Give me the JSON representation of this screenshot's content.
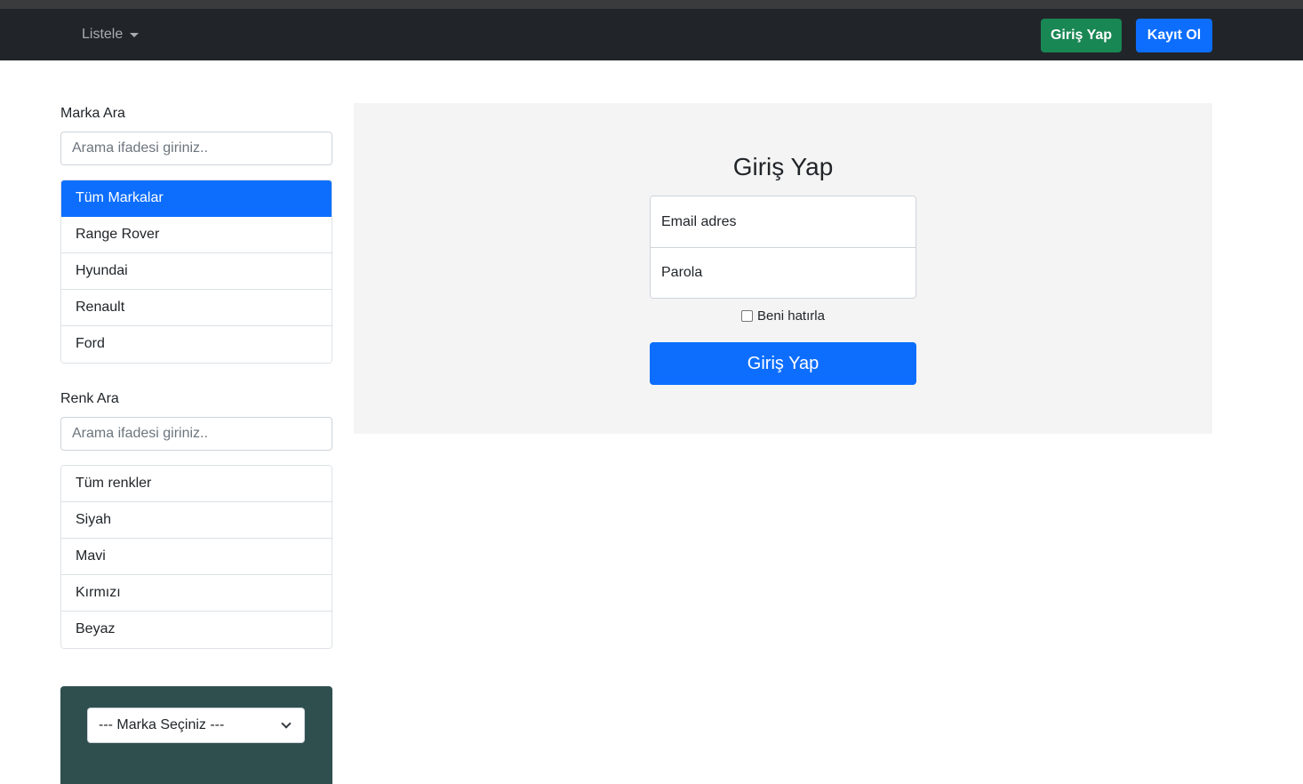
{
  "navbar": {
    "dropdown_label": "Listele",
    "login_label": "Giriş Yap",
    "register_label": "Kayıt Ol"
  },
  "brand_search": {
    "label": "Marka Ara",
    "placeholder": "Arama ifadesi giriniz..",
    "items": [
      {
        "label": "Tüm Markalar",
        "active": true
      },
      {
        "label": "Range Rover",
        "active": false
      },
      {
        "label": "Hyundai",
        "active": false
      },
      {
        "label": "Renault",
        "active": false
      },
      {
        "label": "Ford",
        "active": false
      }
    ]
  },
  "color_search": {
    "label": "Renk Ara",
    "placeholder": "Arama ifadesi giriniz..",
    "items": [
      {
        "label": "Tüm renkler",
        "active": false
      },
      {
        "label": "Siyah",
        "active": false
      },
      {
        "label": "Mavi",
        "active": false
      },
      {
        "label": "Kırmızı",
        "active": false
      },
      {
        "label": "Beyaz",
        "active": false
      }
    ]
  },
  "filter_panel": {
    "brand_select_value": "--- Marka Seçiniz ---"
  },
  "login_form": {
    "title": "Giriş Yap",
    "email_placeholder": "Email adres",
    "password_placeholder": "Parola",
    "remember_label": "Beni hatırla",
    "remember_checked": false,
    "submit_label": "Giriş Yap"
  },
  "colors": {
    "navbar_bg": "#212529",
    "primary": "#0d6efd",
    "success": "#198754",
    "panel_bg": "#f4f4f4",
    "filter_panel_bg": "#2f4f4f"
  }
}
